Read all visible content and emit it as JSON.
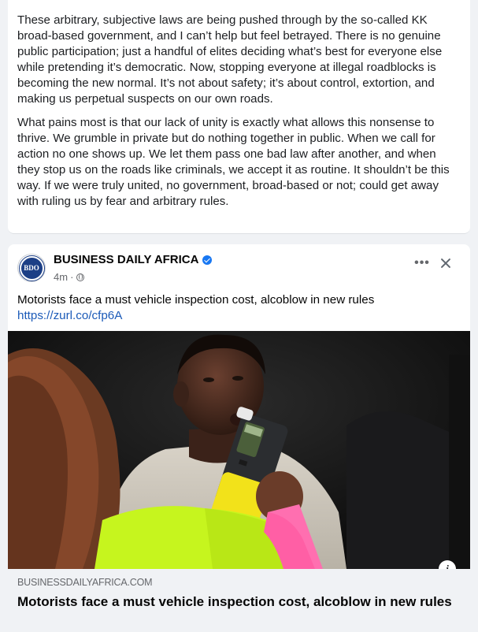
{
  "post_body": {
    "paragraph_1": "These arbitrary, subjective laws are being pushed through by the so-called KK broad-based government, and I can’t help but feel betrayed. There is no genuine public participation; just a handful of elites deciding what’s best for everyone else while pretending it’s democratic. Now, stopping everyone at illegal roadblocks is becoming the new normal. It’s not about safety; it’s about control, extortion, and making us perpetual suspects on our own roads.",
    "paragraph_2": "What pains most is that our lack of unity is exactly what allows this nonsense to thrive. We grumble in private but do nothing together in public. When we call for action no one shows up. We let them pass one bad law after another, and when they stop us on the roads like criminals, we accept it as routine. It shouldn’t be this way. If we were truly united, no government, broad-based or not; could get away with ruling us by fear and arbitrary rules."
  },
  "shared_post": {
    "avatar_text": "BDO",
    "page_name": "BUSINESS DAILY AFRICA",
    "time": "4m",
    "more_label": "•••",
    "text": "Motorists face a must vehicle inspection cost, alcoblow in new rules",
    "link": "https://zurl.co/cfp6A",
    "info_label": "i",
    "preview": {
      "domain": "BUSINESSDAILYAFRICA.COM",
      "headline": "Motorists face a must vehicle inspection cost, alcoblow in new rules"
    }
  },
  "colors": {
    "accent": "#1877f2",
    "link": "#1b5ab8",
    "secondary_text": "#65676b",
    "breathalyzer": "#f2e21a"
  },
  "icons": [
    "verified-badge-icon",
    "globe-icon",
    "more-options-icon",
    "close-icon",
    "info-icon"
  ]
}
